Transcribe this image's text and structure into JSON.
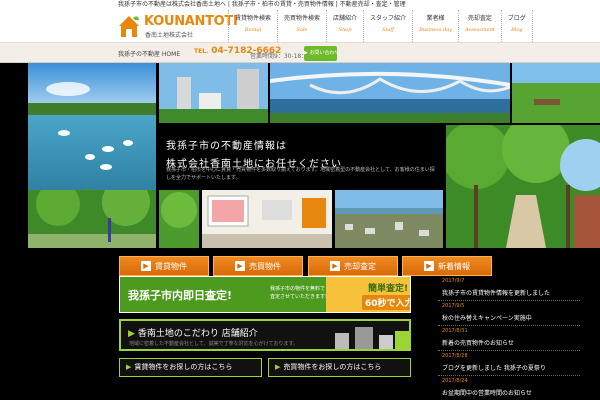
{
  "topbar": {
    "text": "我孫子市の不動産は株式会社香南土地へ | 我孫子市・柏市の賃貸・売買物件情報 | 不動産売却・査定・管理"
  },
  "header": {
    "logo_text": "KOUNANTOTI",
    "logo_sub": "香南土地株式会社",
    "nav": [
      {
        "jp": "賃貸物件検索",
        "en": "Rental"
      },
      {
        "jp": "売買物件検索",
        "en": "Sale"
      },
      {
        "jp": "店舗紹介",
        "en": "Shop"
      },
      {
        "jp": "スタッフ紹介",
        "en": "Staff"
      },
      {
        "jp": "業者様",
        "en": "Business day"
      },
      {
        "jp": "売却査定",
        "en": "Assessment"
      },
      {
        "jp": "ブログ",
        "en": "Blog"
      }
    ]
  },
  "subbar": {
    "breadcrumb": "我孫子の不動産 HOME",
    "tel_label": "TEL.",
    "tel": "04-7182-6662",
    "hours": "営業時間9：30-18：00",
    "contact": "▶ お問い合わせ"
  },
  "hero": {
    "title_line1": "我孫子市の不動産情報は",
    "title_line2": "株式会社香南土地にお任せください",
    "desc": "我孫子市・柏市を中心に賃貸・売買物件を多数取り揃えております。地域密着型の不動産会社として、お客様の住まい探しを全力でサポートいたします。"
  },
  "buttons": [
    {
      "label": "賃貸物件"
    },
    {
      "label": "売買物件"
    },
    {
      "label": "売却査定"
    },
    {
      "label": "新着情報"
    }
  ],
  "banner": {
    "main": "我孫子市内即日査定!",
    "sub1": "我孫子市の物件を無料で",
    "sub2": "査定させていただきます!",
    "badge1": "簡単査定!",
    "badge2": "60秒で入力完了!"
  },
  "gbox": {
    "title": "香南土地のこだわり 店舗紹介",
    "sub": "地域に密着した不動産会社として、誠実で丁寧な対応を心がけております。"
  },
  "small_buttons": [
    {
      "label": "賃貸物件をお探しの方はこちら"
    },
    {
      "label": "売買物件をお探しの方はこちら"
    }
  ],
  "news": [
    {
      "date": "2017/9/7",
      "title": "我孫子市の賃貸物件情報を更新しました"
    },
    {
      "date": "2017/9/5",
      "title": "秋の住み替えキャンペーン実施中"
    },
    {
      "date": "2017/8/31",
      "title": "新着の売買物件のお知らせ"
    },
    {
      "date": "2017/8/28",
      "title": "ブログを更新しました 我孫子の夏祭り"
    },
    {
      "date": "2017/8/24",
      "title": "お盆期間中の営業時間のお知らせ"
    }
  ]
}
